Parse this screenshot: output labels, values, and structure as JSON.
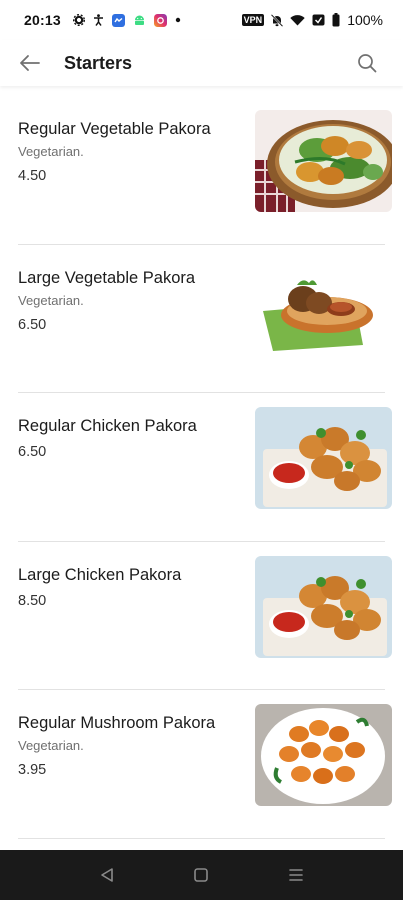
{
  "status_bar": {
    "time": "20:13",
    "vpn_label": "VPN",
    "battery": "100%"
  },
  "app_bar": {
    "title": "Starters"
  },
  "menu_items": [
    {
      "name": "Regular Vegetable Pakora",
      "description": "Vegetarian.",
      "price": "4.50",
      "image": "vegetable-pakora-basket-photo"
    },
    {
      "name": "Large Vegetable Pakora",
      "description": "Vegetarian.",
      "price": "6.50",
      "image": "vegetable-pakora-plate-photo"
    },
    {
      "name": "Regular Chicken Pakora",
      "description": "",
      "price": "6.50",
      "image": "chicken-pakora-board-photo"
    },
    {
      "name": "Large Chicken Pakora",
      "description": "",
      "price": "8.50",
      "image": "chicken-pakora-board-photo"
    },
    {
      "name": "Regular Mushroom Pakora",
      "description": "Vegetarian.",
      "price": "3.95",
      "image": "mushroom-pakora-plate-photo"
    }
  ],
  "icons": {
    "back": "arrow-left-icon",
    "search": "search-icon",
    "nav_back": "triangle-back-icon",
    "nav_home": "square-home-icon",
    "nav_recents": "menu-lines-icon"
  },
  "colors": {
    "text_primary": "#1c1c1c",
    "text_secondary": "#707070",
    "divider": "#e2e2e2",
    "nav_bar": "#1a1a1a"
  }
}
